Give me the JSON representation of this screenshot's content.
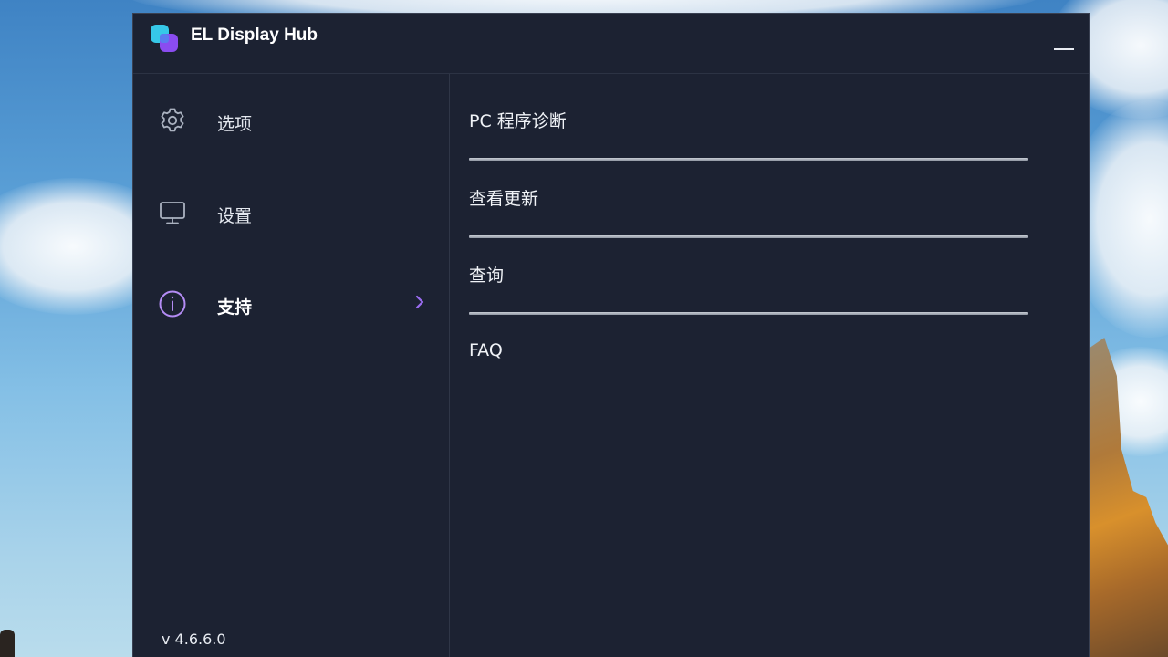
{
  "window": {
    "title": "EL Display Hub",
    "colors": {
      "background": "#1c2232",
      "accent": "#9a6cf0"
    }
  },
  "sidebar": {
    "items": [
      {
        "label": "选项",
        "icon": "gear-icon",
        "active": false
      },
      {
        "label": "设置",
        "icon": "monitor-icon",
        "active": false
      },
      {
        "label": "支持",
        "icon": "info-icon",
        "active": true
      }
    ],
    "version": "v 4.6.6.0"
  },
  "content": {
    "items": [
      {
        "label": "PC 程序诊断"
      },
      {
        "label": "查看更新"
      },
      {
        "label": "查询"
      },
      {
        "label": "FAQ"
      }
    ]
  }
}
